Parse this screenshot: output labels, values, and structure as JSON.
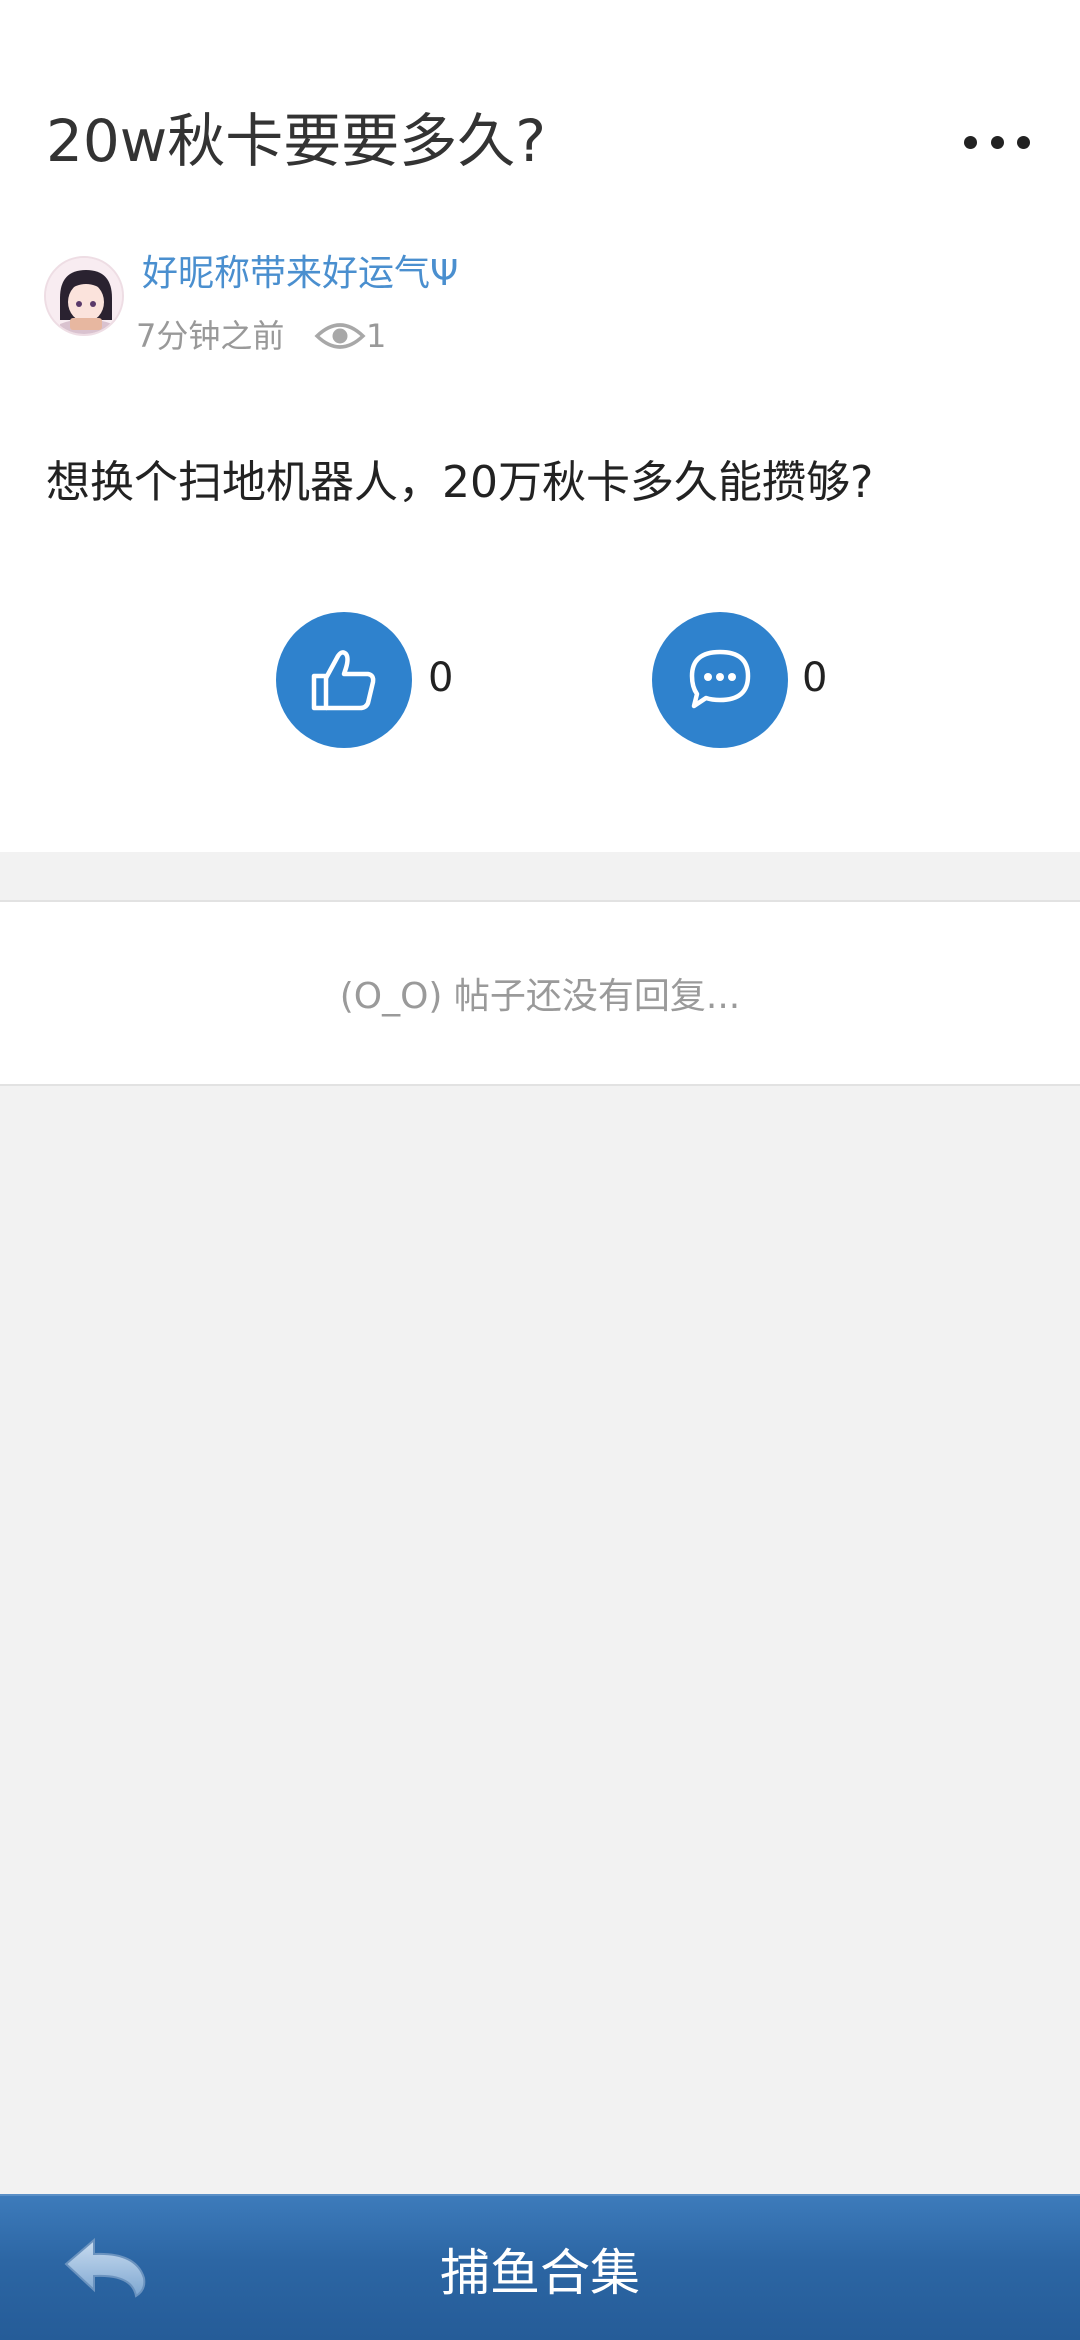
{
  "post": {
    "title": "20w秋卡要要多久?",
    "author": "好昵称带来好运气Ψ",
    "time": "7分钟之前",
    "views": "1",
    "body": "想换个扫地机器人，20万秋卡多久能攒够?"
  },
  "actions": {
    "like_count": "0",
    "comment_count": "0"
  },
  "replies": {
    "empty_text": "(O_O) 帖子还没有回复..."
  },
  "bottom_bar": {
    "title": "捕鱼合集"
  },
  "colors": {
    "accent": "#2f82cd",
    "author": "#4a8fcf",
    "bar": "#2c66a4"
  }
}
